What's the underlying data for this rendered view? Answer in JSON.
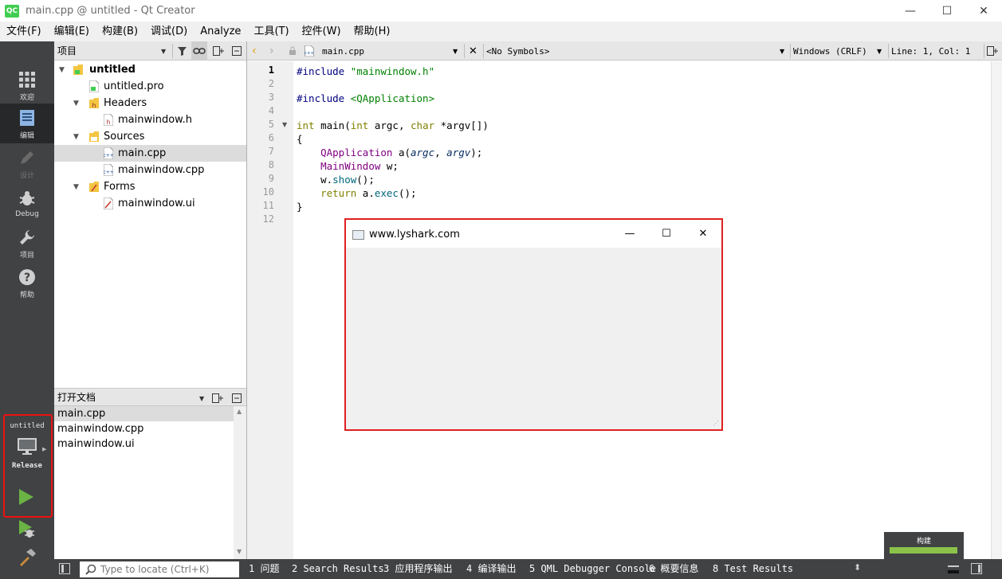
{
  "window": {
    "logo_text": "QC",
    "title": "main.cpp @ untitled - Qt Creator",
    "minimize": "—",
    "maximize": "☐",
    "close": "✕"
  },
  "menubar": [
    "文件(F)",
    "编辑(E)",
    "构建(B)",
    "调试(D)",
    "Analyze",
    "工具(T)",
    "控件(W)",
    "帮助(H)"
  ],
  "modes": [
    {
      "label": "欢迎",
      "icon": "grid-icon"
    },
    {
      "label": "编辑",
      "icon": "document-icon"
    },
    {
      "label": "设计",
      "icon": "pencil-icon"
    },
    {
      "label": "Debug",
      "icon": "bug-icon"
    },
    {
      "label": "项目",
      "icon": "wrench-icon"
    },
    {
      "label": "帮助",
      "icon": "help-icon"
    }
  ],
  "kit": {
    "project": "untitled",
    "build": "Release"
  },
  "project_panel": {
    "title": "项目",
    "tree": [
      {
        "label": "untitled",
        "level": 0,
        "type": "project"
      },
      {
        "label": "untitled.pro",
        "level": 1,
        "type": "pro"
      },
      {
        "label": "Headers",
        "level": 1,
        "type": "folder-h"
      },
      {
        "label": "mainwindow.h",
        "level": 2,
        "type": "h"
      },
      {
        "label": "Sources",
        "level": 1,
        "type": "folder-cpp"
      },
      {
        "label": "main.cpp",
        "level": 2,
        "type": "cpp"
      },
      {
        "label": "mainwindow.cpp",
        "level": 2,
        "type": "cpp"
      },
      {
        "label": "Forms",
        "level": 1,
        "type": "folder-ui"
      },
      {
        "label": "mainwindow.ui",
        "level": 2,
        "type": "ui"
      }
    ]
  },
  "open_docs": {
    "title": "打开文档",
    "items": [
      "main.cpp",
      "mainwindow.cpp",
      "mainwindow.ui"
    ]
  },
  "editor_toolbar": {
    "file": "main.cpp",
    "symbols": "<No Symbols>",
    "line_endings": "Windows (CRLF)",
    "position": "Line: 1, Col: 1"
  },
  "editor": {
    "line_numbers": [
      "1",
      "2",
      "3",
      "4",
      "5",
      "6",
      "7",
      "8",
      "9",
      "10",
      "11",
      "12"
    ],
    "lines": [
      [
        {
          "t": "#include ",
          "c": "pp"
        },
        {
          "t": "\"mainwindow.h\"",
          "c": "str"
        }
      ],
      [],
      [
        {
          "t": "#include ",
          "c": "pp"
        },
        {
          "t": "<QApplication>",
          "c": "str"
        }
      ],
      [],
      [
        {
          "t": "int",
          "c": "kw"
        },
        {
          "t": " ",
          "c": ""
        },
        {
          "t": "main",
          "c": "pl"
        },
        {
          "t": "(",
          "c": ""
        },
        {
          "t": "int",
          "c": "kw"
        },
        {
          "t": " argc, ",
          "c": ""
        },
        {
          "t": "char",
          "c": "kw"
        },
        {
          "t": " *argv[])",
          "c": ""
        }
      ],
      [
        {
          "t": "{",
          "c": ""
        }
      ],
      [
        {
          "t": "    ",
          "c": ""
        },
        {
          "t": "QApplication",
          "c": "ty"
        },
        {
          "t": " a(",
          "c": ""
        },
        {
          "t": "argc",
          "c": "it"
        },
        {
          "t": ", ",
          "c": ""
        },
        {
          "t": "argv",
          "c": "it"
        },
        {
          "t": ");",
          "c": ""
        }
      ],
      [
        {
          "t": "    ",
          "c": ""
        },
        {
          "t": "MainWindow",
          "c": "ty"
        },
        {
          "t": " w;",
          "c": ""
        }
      ],
      [
        {
          "t": "    w.",
          "c": ""
        },
        {
          "t": "show",
          "c": "fn"
        },
        {
          "t": "();",
          "c": ""
        }
      ],
      [
        {
          "t": "    ",
          "c": ""
        },
        {
          "t": "return",
          "c": "kw"
        },
        {
          "t": " a.",
          "c": ""
        },
        {
          "t": "exec",
          "c": "fn"
        },
        {
          "t": "();",
          "c": ""
        }
      ],
      [
        {
          "t": "}",
          "c": ""
        }
      ],
      []
    ]
  },
  "popup": {
    "title": "www.lyshark.com",
    "minimize": "—",
    "maximize": "☐",
    "close": "✕"
  },
  "build_progress": {
    "label": "构建",
    "fraction": 1.0
  },
  "statusbar": {
    "locate_placeholder": "Type to locate (Ctrl+K)",
    "tabs": [
      "1 问题",
      "2 Search Results",
      "3 应用程序输出",
      "4 编译输出",
      "5 QML Debugger Console",
      "6 概要信息",
      "8 Test Results"
    ]
  },
  "colors": {
    "accent_red": "#e02020",
    "run_green": "#6ab344",
    "sidebar": "#404244"
  }
}
